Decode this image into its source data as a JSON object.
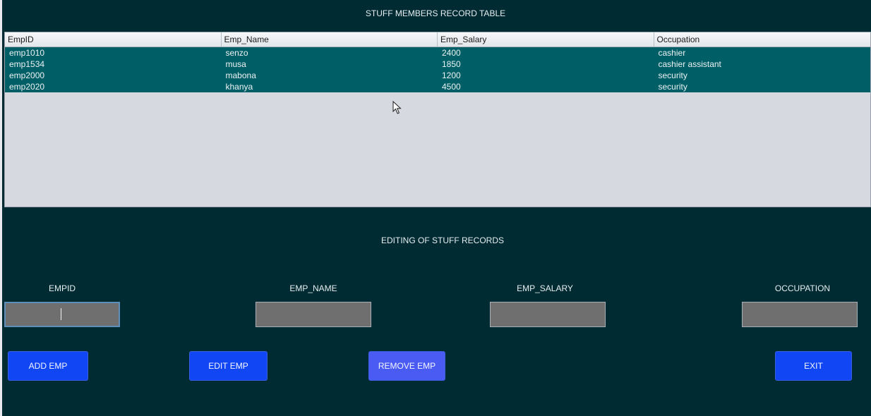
{
  "window": {
    "table_title": "STUFF MEMBERS RECORD TABLE",
    "edit_title": "EDITING OF STUFF RECORDS"
  },
  "table": {
    "columns": [
      "EmpID",
      "Emp_Name",
      "Emp_Salary",
      "Occupation"
    ],
    "rows": [
      [
        "emp1010",
        "senzo",
        "2400",
        "cashier"
      ],
      [
        "emp1534",
        "musa",
        "1850",
        "cashier assistant"
      ],
      [
        "emp2000",
        "mabona",
        "1200",
        "security"
      ],
      [
        "emp2020",
        "khanya",
        "4500",
        "security"
      ]
    ]
  },
  "form": {
    "labels": {
      "empid": "EMPID",
      "emp_name": "EMP_NAME",
      "emp_salary": "EMP_SALARY",
      "occupation": "OCCUPATION"
    },
    "values": {
      "empid": "",
      "emp_name": "",
      "emp_salary": "",
      "occupation": ""
    }
  },
  "buttons": {
    "add": "ADD EMP",
    "edit": "EDIT EMP",
    "remove": "REMOVE EMP",
    "exit": "EXIT"
  },
  "colors": {
    "background": "#002b33",
    "row_highlight": "#005f66",
    "button_blue": "#1146f5",
    "button_light_blue": "#4a5bf3"
  }
}
